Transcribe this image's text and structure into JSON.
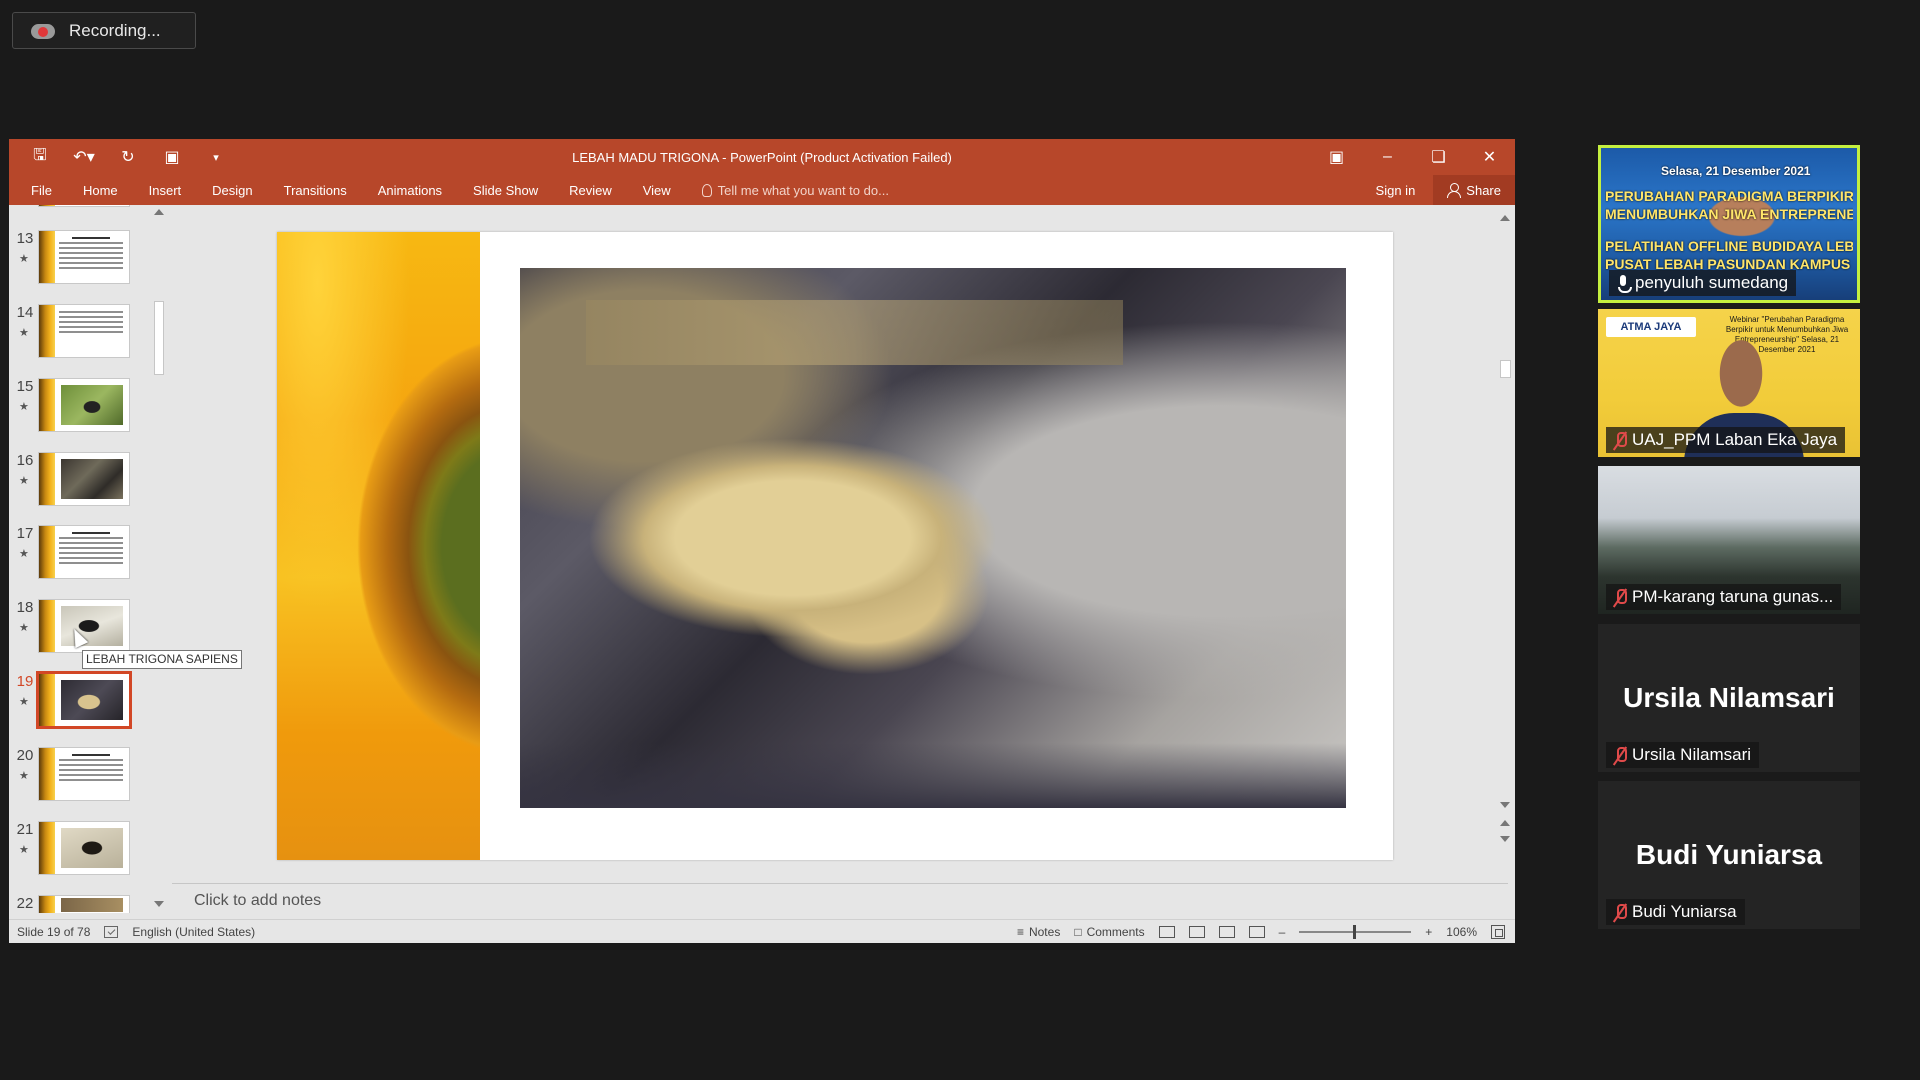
{
  "recording": {
    "label": "Recording..."
  },
  "window": {
    "title": "LEBAH MADU TRIGONA - PowerPoint (Product Activation Failed)",
    "accent": "#b7472a"
  },
  "ribbon": {
    "tabs": [
      "File",
      "Home",
      "Insert",
      "Design",
      "Transitions",
      "Animations",
      "Slide Show",
      "Review",
      "View"
    ],
    "tell_me": "Tell me what you want to do...",
    "sign_in": "Sign in",
    "share": "Share"
  },
  "thumbnails": [
    {
      "num": "13",
      "kind": "text"
    },
    {
      "num": "14",
      "kind": "text"
    },
    {
      "num": "15",
      "kind": "photo-bee"
    },
    {
      "num": "16",
      "kind": "photo-hive"
    },
    {
      "num": "17",
      "kind": "text"
    },
    {
      "num": "18",
      "kind": "photo-bee2"
    },
    {
      "num": "19",
      "kind": "photo-comb",
      "selected": true
    },
    {
      "num": "20",
      "kind": "text"
    },
    {
      "num": "21",
      "kind": "photo-bee3"
    },
    {
      "num": "22",
      "kind": "text"
    }
  ],
  "tooltip": "LEBAH TRIGONA SAPIENS",
  "notes": {
    "placeholder": "Click to add notes"
  },
  "status": {
    "slide": "Slide 19 of 78",
    "language": "English (United States)",
    "notes": "Notes",
    "comments": "Comments",
    "zoom": "106%"
  },
  "participants": [
    {
      "name": "penyuluh sumedang",
      "muted": false,
      "speaking": true,
      "banner": [
        "Selasa, 21 Desember 2021",
        "PERUBAHAN PARADIGMA BERPIKIR",
        "MENUMBUHKAN JIWA ENTREPRENEURSHIP",
        "PELATIHAN OFFLINE BUDIDAYA LEBAH MADU",
        "PUSAT LEBAH PASUNDAN KAMPUS DESA"
      ]
    },
    {
      "name": "UAJ_PPM Laban Eka Jaya",
      "muted": true,
      "logo": "ATMA JAYA",
      "webinar": "Webinar \"Perubahan Paradigma Berpikir untuk Menumbuhkan Jiwa Entrepreneurship\" Selasa, 21 Desember 2021"
    },
    {
      "name": "PM-karang taruna gunas...",
      "muted": true
    },
    {
      "name": "Ursila Nilamsari",
      "muted": true,
      "avatar_text": "Ursila Nilamsari"
    },
    {
      "name": "Budi Yuniarsa",
      "muted": true,
      "avatar_text": "Budi Yuniarsa"
    }
  ]
}
